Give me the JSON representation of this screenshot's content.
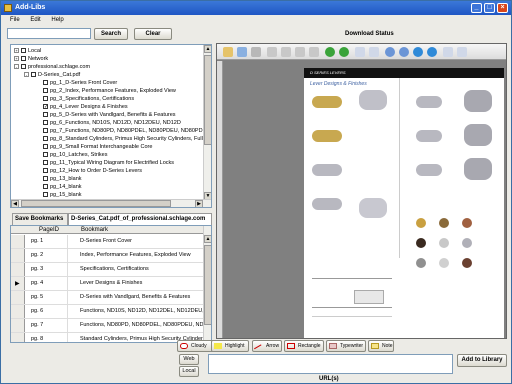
{
  "window": {
    "title": "Add-Libs"
  },
  "menu": [
    "File",
    "Edit",
    "Help"
  ],
  "search": {
    "value": "",
    "search_label": "Search",
    "clear_label": "Clear"
  },
  "download_status": "Download Status",
  "tree": [
    {
      "label": "Local",
      "expander": "+",
      "checked": false,
      "level": 1
    },
    {
      "label": "Network",
      "expander": "+",
      "checked": false,
      "level": 1
    },
    {
      "label": "professional.schlage.com",
      "expander": "-",
      "checked": false,
      "level": 1
    },
    {
      "label": "D-Series_Cat.pdf",
      "expander": "-",
      "checked": false,
      "level": 2
    },
    {
      "label": "pg_1_D-Series Front Cover",
      "expander": "",
      "checked": false,
      "level": 3
    },
    {
      "label": "pg_2_Index, Performance Features, Exploded View",
      "expander": "",
      "checked": false,
      "level": 3
    },
    {
      "label": "pg_3_Specifications, Certifications",
      "expander": "",
      "checked": false,
      "level": 3
    },
    {
      "label": "pg_4_Lever Designs & Finishes",
      "expander": "",
      "checked": true,
      "level": 3
    },
    {
      "label": "pg_5_D-Series with Vandlgard, Benefits & Features",
      "expander": "",
      "checked": false,
      "level": 3
    },
    {
      "label": "pg_6_Functions, ND10S, ND12D, ND12DEU, ND12D",
      "expander": "",
      "checked": false,
      "level": 3
    },
    {
      "label": "pg_7_Functions, ND80PD, ND80PDEL, ND80PDEU, ND80PD",
      "expander": "",
      "checked": false,
      "level": 3
    },
    {
      "label": "pg_8_Standard Cylinders, Primus High Security Cylinders, Full Si",
      "expander": "",
      "checked": false,
      "level": 3
    },
    {
      "label": "pg_9_Small Format Interchangeable Core",
      "expander": "",
      "checked": false,
      "level": 3
    },
    {
      "label": "pg_10_Latches, Strikes",
      "expander": "",
      "checked": false,
      "level": 3
    },
    {
      "label": "pg_11_Typical Wiring Diagram for Electrified Locks",
      "expander": "",
      "checked": false,
      "level": 3
    },
    {
      "label": "pg_12_How to Order D-Series Levers",
      "expander": "",
      "checked": false,
      "level": 3
    },
    {
      "label": "pg_13_blank",
      "expander": "",
      "checked": false,
      "level": 3
    },
    {
      "label": "pg_14_blank",
      "expander": "",
      "checked": false,
      "level": 3
    },
    {
      "label": "pg_15_blank",
      "expander": "",
      "checked": false,
      "level": 3
    }
  ],
  "tabs": {
    "save_bookmarks": "Save Bookmarks",
    "file_tab": "D-Series_Cat.pdf_of_professional.schlage.com"
  },
  "grid": {
    "headers": [
      "PageID",
      "Bookmark"
    ],
    "rows": [
      {
        "page": "pg. 1",
        "bookmark": "D-Series Front Cover",
        "current": false
      },
      {
        "page": "pg. 2",
        "bookmark": "Index, Performance Features,  Exploded View",
        "current": false
      },
      {
        "page": "pg. 3",
        "bookmark": "Specifications, Certifications",
        "current": false
      },
      {
        "page": "pg. 4",
        "bookmark": "Lever Designs & Finishes",
        "current": true
      },
      {
        "page": "pg. 5",
        "bookmark": "D-Series with Vandlgard, Benefits & Features",
        "current": false
      },
      {
        "page": "pg. 6",
        "bookmark": "Functions, ND10S, ND12D, ND12DEL, ND12DEU,",
        "current": false
      },
      {
        "page": "pg. 7",
        "bookmark": "Functions, ND80PD, ND80PDEL, ND80PDEU, ND80",
        "current": false
      },
      {
        "page": "pg. 8",
        "bookmark": "Standard Cylinders, Primus High Security Cylinders, Ful",
        "current": false
      }
    ]
  },
  "pdf": {
    "header_band": "D SERIES LEVERS",
    "subheading": "Lever Designs & Finishes"
  },
  "annotations": [
    "Cloudy",
    "Highlight",
    "Arrow",
    "Rectangle",
    "Typewriter",
    "Note"
  ],
  "url": {
    "value": "",
    "label": "URL(s)",
    "web_label": "Web",
    "local_label": "Local",
    "add_label": "Add to Library"
  }
}
